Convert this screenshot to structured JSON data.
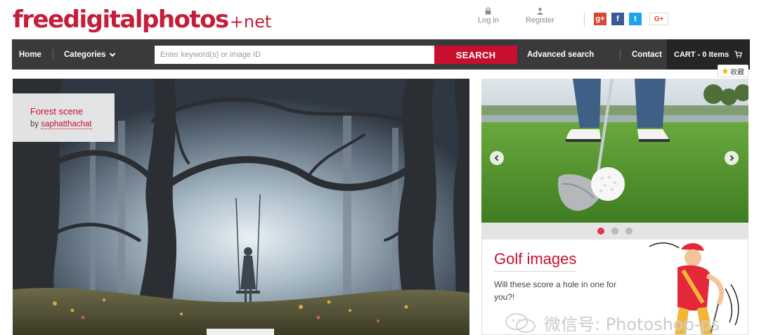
{
  "logo": {
    "main": "freedigitalphotos",
    "suffix": "+net"
  },
  "account": {
    "login": "Log in",
    "register": "Register"
  },
  "social": {
    "google_plus": "g+",
    "facebook": "f",
    "twitter": "t",
    "gplus_one": "G+"
  },
  "nav": {
    "home": "Home",
    "categories": "Categories",
    "search_placeholder": "Enter keyword(s) or image ID",
    "search_button": "SEARCH",
    "advanced_search": "Advanced search",
    "contact": "Contact",
    "cart": "CART - 0 Items"
  },
  "favorite_label": "收藏",
  "hero": {
    "title": "Forest scene",
    "by": "by",
    "author": "saphatthachat"
  },
  "slider": {
    "dot_count": 3,
    "active_dot": 1
  },
  "promo": {
    "title": "Golf images",
    "text": "Will these score a hole in one for you?!"
  },
  "watermark": "微信号: Photoshop-ps",
  "colors": {
    "brand_red": "#c8102e",
    "nav_bg": "#3a3a3a",
    "cart_bg": "#252525"
  }
}
